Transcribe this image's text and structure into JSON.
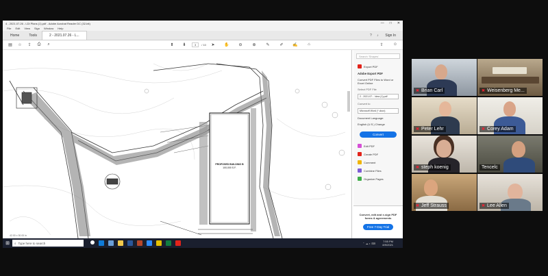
{
  "window": {
    "title": "4 - 2021.07.26 - LDI Plans (1).pdf - Adobe Acrobat Reader DC (32-bit)",
    "controls": [
      "—",
      "□",
      "✕"
    ]
  },
  "menubar": [
    "File",
    "Edit",
    "View",
    "Sign",
    "Window",
    "Help"
  ],
  "tabs": {
    "home": "Home",
    "tools": "Tools",
    "document": "2 - 2021.07.26 - L...",
    "sign_in": "Sign In"
  },
  "toolbar": {
    "page_current": "3",
    "page_total": "/ 10"
  },
  "document": {
    "building_label": "PROPOSED BUILDING B\n100,000 S.F.",
    "status": "42.00 x 30.00 in"
  },
  "panel": {
    "search_placeholder": "Search 'Shapes'",
    "export_pdf": "Export PDF",
    "adobe_export_title": "Adobe Export PDF",
    "adobe_export_desc": "Convert PDF Files to Word or Excel Online",
    "select_file_label": "Select PDF File",
    "selected_file": "2 - 2021.07... Idea (1).pdf",
    "convert_to_label": "Convert to",
    "convert_to_value": "Microsoft Word (*.docx)",
    "document_language": "Document Language:",
    "language_value": "English (U.S.) Change",
    "convert_button": "Convert",
    "tools": [
      "Edit PDF",
      "Create PDF",
      "Comment",
      "Combine Files",
      "Organize Pages"
    ],
    "promo_text": "Convert, edit and e-sign PDF forms & agreements",
    "trial_button": "Free 7-Day Trial"
  },
  "taskbar": {
    "search_placeholder": "Type here to search",
    "time": "7:55 PM",
    "date": "8/9/2021"
  },
  "participants": [
    {
      "name": "Brian Carl"
    },
    {
      "name": "Weisenberg Me..."
    },
    {
      "name": "Peter Lehr"
    },
    {
      "name": "Corey Adam"
    },
    {
      "name": "steph koenig"
    },
    {
      "name": "Tencelc"
    },
    {
      "name": "Jeff Strauss"
    },
    {
      "name": "Lee Allen"
    }
  ],
  "colors": {
    "accent_blue": "#1473e6",
    "active_speaker": "#8fc43a",
    "muted_red": "#e2231a"
  }
}
